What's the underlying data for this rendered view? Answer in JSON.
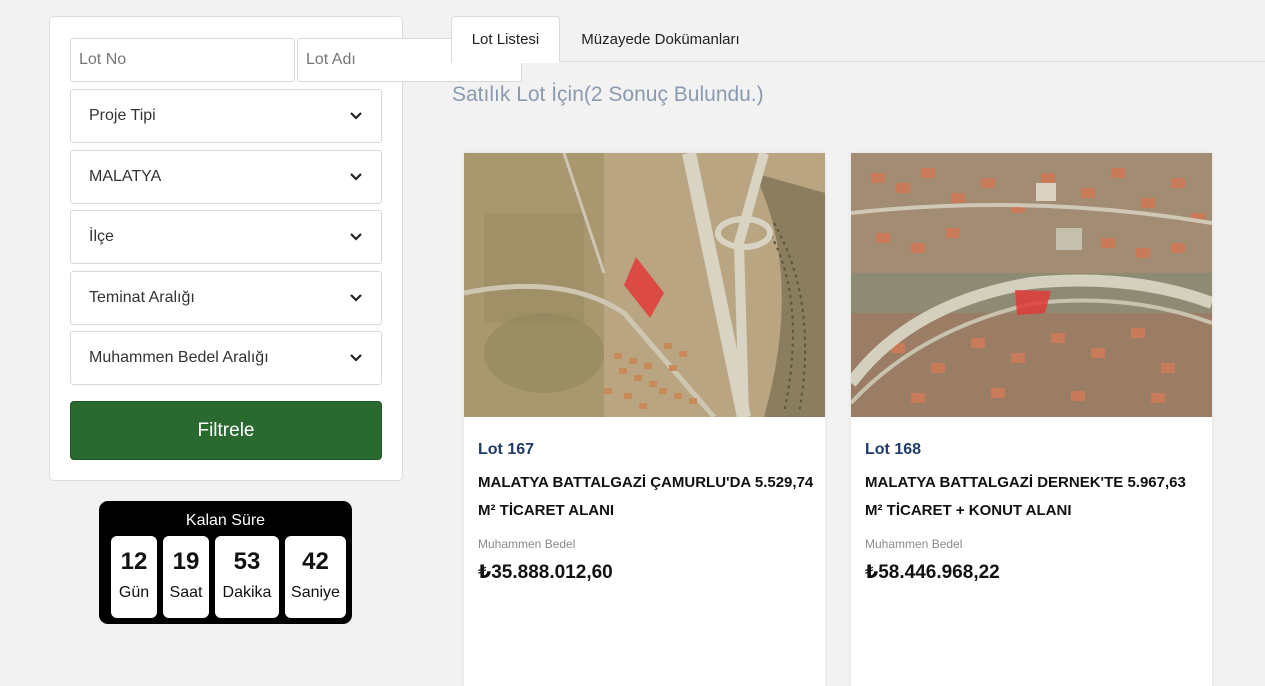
{
  "filters": {
    "lot_no_placeholder": "Lot No",
    "lot_name_placeholder": "Lot Adı",
    "selects": [
      {
        "value": "Proje Tipi"
      },
      {
        "value": "MALATYA"
      },
      {
        "value": "İlçe"
      },
      {
        "value": "Teminat Aralığı"
      },
      {
        "value": "Muhammen Bedel Aralığı"
      }
    ],
    "filter_button": "Filtrele"
  },
  "countdown": {
    "title": "Kalan Süre",
    "units": [
      {
        "value": "12",
        "label": "Gün"
      },
      {
        "value": "19",
        "label": "Saat"
      },
      {
        "value": "53",
        "label": "Dakika"
      },
      {
        "value": "42",
        "label": "Saniye"
      }
    ]
  },
  "tabs": [
    {
      "label": "Lot Listesi",
      "active": true
    },
    {
      "label": "Müzayede Dokümanları",
      "active": false
    }
  ],
  "results_title": "Satılık Lot İçin(2 Sonuç Bulundu.)",
  "lots": [
    {
      "lot_no": "Lot 167",
      "title": "MALATYA BATTALGAZİ ÇAMURLU'DA 5.529,74 M² TİCARET ALANI",
      "price_label": "Muhammen Bedel",
      "price": "₺35.888.012,60"
    },
    {
      "lot_no": "Lot 168",
      "title": "MALATYA BATTALGAZİ DERNEK'TE 5.967,63 M² TİCARET + KONUT ALANI",
      "price_label": "Muhammen Bedel",
      "price": "₺58.446.968,22"
    }
  ],
  "colors": {
    "primary_button": "#2a6a31",
    "lot_no": "#1f3a6b",
    "results_title": "#8a9bb0",
    "parcel_highlight": "#e23a3a"
  }
}
